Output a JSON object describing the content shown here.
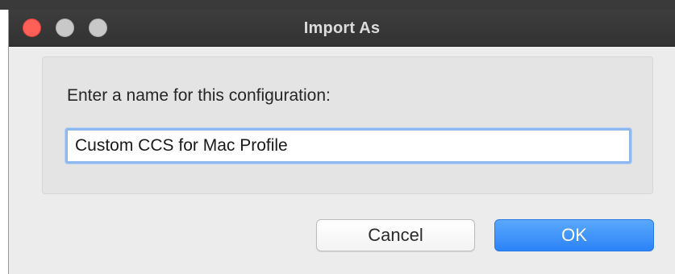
{
  "window": {
    "title": "Import As"
  },
  "titlebar": {
    "buttons": [
      {
        "icon": "close-icon",
        "color": "#fe5f57"
      },
      {
        "icon": "minimize-icon",
        "color": "#c8c8c8"
      },
      {
        "icon": "zoom-icon",
        "color": "#c8c8c8"
      }
    ]
  },
  "dialog": {
    "prompt": "Enter a name for this configuration:",
    "name_value": "Custom CCS for Mac Profile",
    "cancel_label": "Cancel",
    "ok_label": "OK"
  },
  "colors": {
    "ok_button": "#2b83f7",
    "focus_ring": "#8fb8ef",
    "titlebar": "#323232"
  }
}
